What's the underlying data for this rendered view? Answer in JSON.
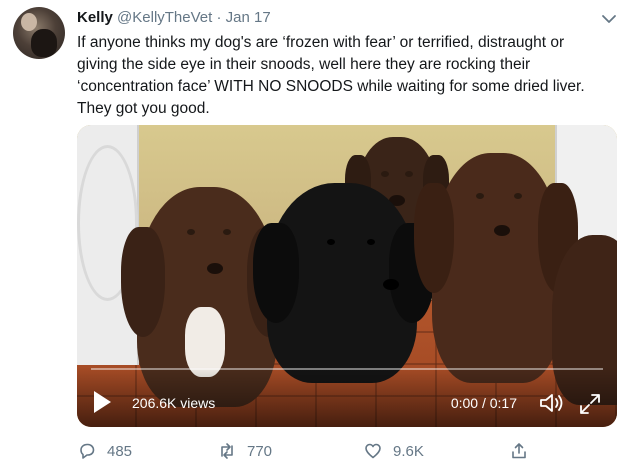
{
  "tweet": {
    "display_name": "Kelly",
    "handle": "@KellyTheVet",
    "separator": "·",
    "date": "Jan 17",
    "text_lines": [
      "If anyone thinks my dog's are ‘frozen with fear’ or terrified, distraught or",
      "giving the side eye in their snoods, well here they are rocking their",
      "‘concentration face’ WITH NO SNOODS while waiting for some dried liver.",
      "They got you good."
    ]
  },
  "video": {
    "views": "206.6K views",
    "time": "0:00 / 0:17",
    "progress": 0.0,
    "icons": [
      "play-icon",
      "volume-icon",
      "fullscreen-icon"
    ]
  },
  "actions": {
    "replies": "485",
    "retweets": "770",
    "likes": "9.6K"
  },
  "colors": {
    "text": "#14171a",
    "secondary": "#657786"
  }
}
